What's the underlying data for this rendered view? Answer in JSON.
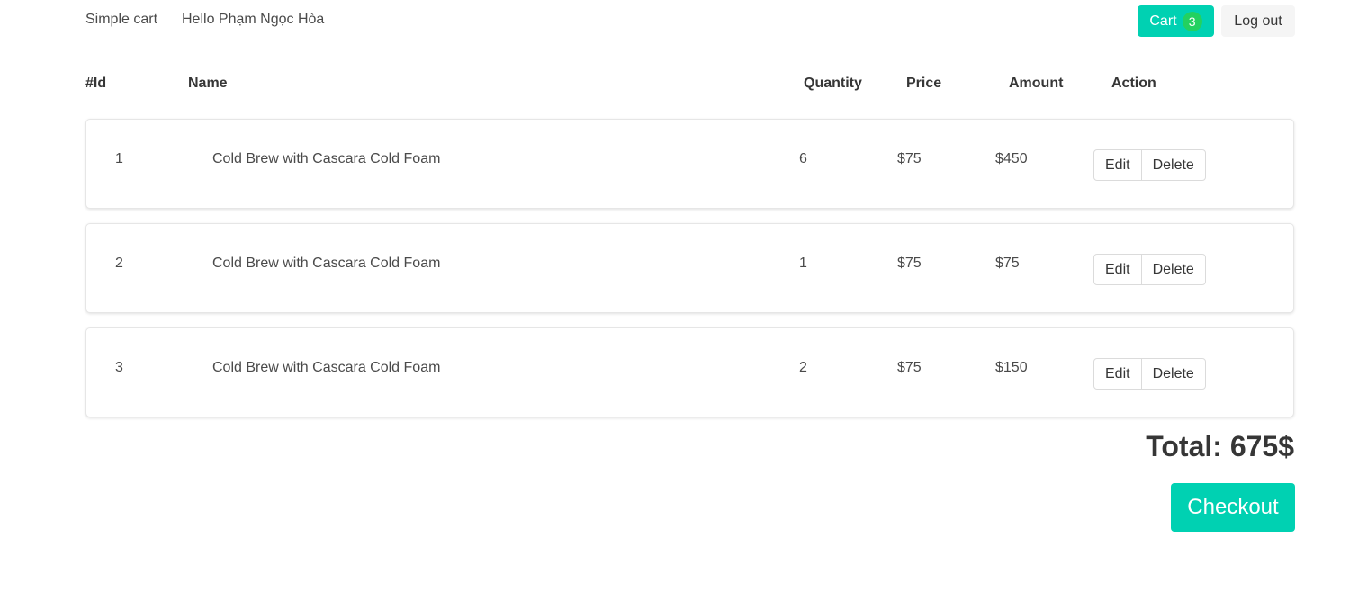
{
  "nav": {
    "brand": "Simple cart",
    "greeting": "Hello Phạm Ngọc Hòa",
    "cart_label": "Cart",
    "cart_count": "3",
    "logout_label": "Log out"
  },
  "table": {
    "headers": {
      "id": "#Id",
      "name": "Name",
      "quantity": "Quantity",
      "price": "Price",
      "amount": "Amount",
      "action": "Action"
    },
    "rows": [
      {
        "id": "1",
        "name": "Cold Brew with Cascara Cold Foam",
        "quantity": "6",
        "price": "$75",
        "amount": "$450",
        "edit": "Edit",
        "delete": "Delete"
      },
      {
        "id": "2",
        "name": "Cold Brew with Cascara Cold Foam",
        "quantity": "1",
        "price": "$75",
        "amount": "$75",
        "edit": "Edit",
        "delete": "Delete"
      },
      {
        "id": "3",
        "name": "Cold Brew with Cascara Cold Foam",
        "quantity": "2",
        "price": "$75",
        "amount": "$150",
        "edit": "Edit",
        "delete": "Delete"
      }
    ]
  },
  "summary": {
    "total": "Total: 675$",
    "checkout_label": "Checkout"
  },
  "colors": {
    "primary": "#00d1b2",
    "badge": "#23d160",
    "light_button": "#f5f5f5"
  }
}
